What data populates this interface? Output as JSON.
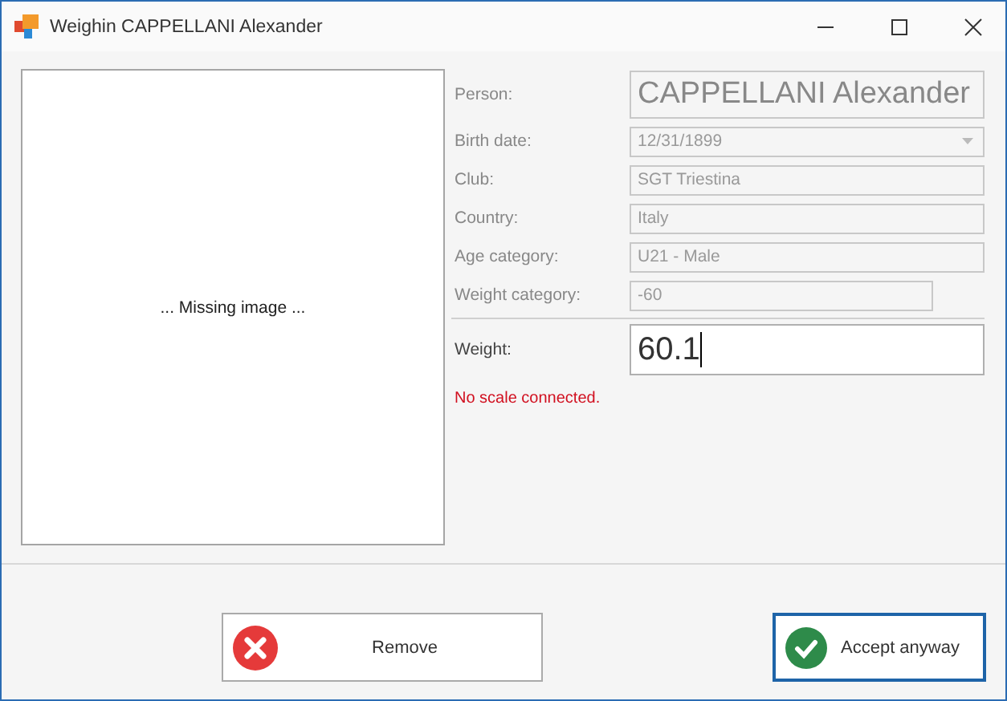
{
  "window": {
    "title": "Weighin CAPPELLANI Alexander"
  },
  "image_panel": {
    "text": "... Missing image ..."
  },
  "fields": [
    {
      "label": "Person:",
      "value": "CAPPELLANI Alexander",
      "kind": "large",
      "disabled": true
    },
    {
      "label": "Birth date:",
      "value": "12/31/1899",
      "kind": "dropdown",
      "disabled": true
    },
    {
      "label": "Club:",
      "value": "SGT Triestina",
      "kind": "text",
      "disabled": true
    },
    {
      "label": "Country:",
      "value": "Italy",
      "kind": "text",
      "disabled": true
    },
    {
      "label": "Age category:",
      "value": "U21 - Male",
      "kind": "text",
      "disabled": true
    },
    {
      "label": "Weight category:",
      "value": "-60",
      "kind": "short",
      "disabled": true
    }
  ],
  "weight": {
    "label": "Weight:",
    "value": "60.1"
  },
  "error": "No scale connected.",
  "buttons": [
    {
      "label": "Remove",
      "kind": "remove",
      "focused": false
    },
    {
      "label": "Accept anyway",
      "kind": "accept",
      "focused": true
    }
  ]
}
